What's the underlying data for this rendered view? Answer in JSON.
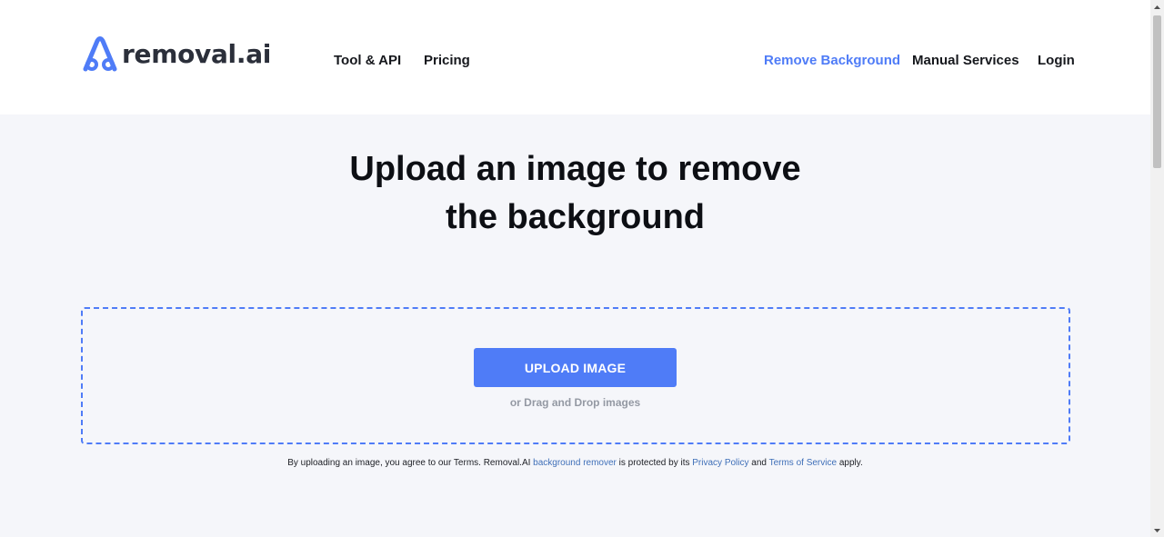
{
  "brand": {
    "name": "removal.ai",
    "accent": "#4f7cf7"
  },
  "nav": {
    "tool_api": "Tool & API",
    "pricing": "Pricing",
    "remove_background": "Remove Background",
    "manual_services": "Manual Services",
    "login": "Login"
  },
  "hero": {
    "title_line1": "Upload an image to remove",
    "title_line2": "the background"
  },
  "upload": {
    "button_label": "UPLOAD IMAGE",
    "drag_drop_text": "or Drag and Drop images"
  },
  "terms": {
    "prefix": "By uploading an image, you agree to our Terms. Removal.AI ",
    "link_remover": "background remover",
    "middle": " is protected by its ",
    "link_privacy": "Privacy Policy",
    "and": " and ",
    "link_tos": "Terms of Service",
    "suffix": " apply."
  }
}
